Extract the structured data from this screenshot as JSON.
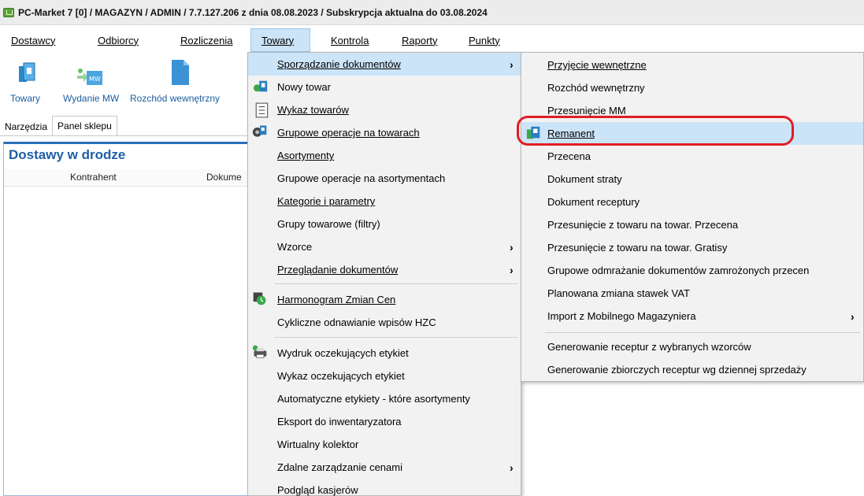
{
  "window": {
    "title": "PC-Market 7 [0] / MAGAZYN / ADMIN / 7.7.127.206 z dnia 08.08.2023 / Subskrypcja aktualna do 03.08.2024"
  },
  "menubar": [
    {
      "label": "Dostawcy",
      "name": "menu-dostawcy"
    },
    {
      "label": "Odbiorcy",
      "name": "menu-odbiorcy"
    },
    {
      "label": "Rozliczenia",
      "name": "menu-rozliczenia"
    },
    {
      "label": "Towary",
      "name": "menu-towary"
    },
    {
      "label": "Kontrola",
      "name": "menu-kontrola"
    },
    {
      "label": "Raporty",
      "name": "menu-raporty"
    },
    {
      "label": "Punkty",
      "name": "menu-punkty"
    }
  ],
  "toolbar": {
    "towary": "Towary",
    "wydanie_mw": "Wydanie MW",
    "rozchod": "Rozchód wewnętrzny",
    "mw_badge": "MW"
  },
  "tabs": {
    "narzedzia": "Narzędzia",
    "panel_sklepu": "Panel sklepu"
  },
  "panel": {
    "title": "Dostawy w drodze",
    "columns": [
      "Kontrahent",
      "Dokume"
    ]
  },
  "towary_menu": [
    {
      "label": "Sporządzanie dokumentów",
      "submenu": true,
      "highlight": true,
      "icon": ""
    },
    {
      "label": "Nowy towar",
      "icon": "new-product-icon"
    },
    {
      "label": "Wykaz towarów",
      "icon": "list-icon"
    },
    {
      "label": "Grupowe operacje na towarach",
      "icon": "group-ops-icon"
    },
    {
      "label": "Asortymenty",
      "icon": ""
    },
    {
      "label": "Grupowe operacje na asortymentach",
      "icon": ""
    },
    {
      "label": "Kategorie i parametry",
      "icon": ""
    },
    {
      "label": "Grupy towarowe (filtry)",
      "icon": ""
    },
    {
      "label": "Wzorce",
      "submenu": true,
      "icon": ""
    },
    {
      "label": "Przeglądanie dokumentów",
      "submenu": true,
      "icon": ""
    },
    {
      "separator": true
    },
    {
      "label": "Harmonogram Zmian Cen",
      "icon": "schedule-icon"
    },
    {
      "label": "Cykliczne odnawianie wpisów HZC",
      "icon": ""
    },
    {
      "separator": true
    },
    {
      "label": "Wydruk oczekujących etykiet",
      "icon": "printer-icon"
    },
    {
      "label": "Wykaz oczekujących etykiet",
      "icon": ""
    },
    {
      "label": "Automatyczne etykiety - które asortymenty",
      "icon": ""
    },
    {
      "label": "Eksport do inwentaryzatora",
      "icon": ""
    },
    {
      "label": "Wirtualny kolektor",
      "icon": ""
    },
    {
      "label": "Zdalne zarządzanie cenami",
      "submenu": true,
      "icon": ""
    },
    {
      "label": "Podgląd kasjerów",
      "icon": ""
    }
  ],
  "documents_submenu": [
    {
      "label": "Przyjęcie wewnętrzne"
    },
    {
      "label": "Rozchód wewnętrzny"
    },
    {
      "label": "Przesunięcie MM"
    },
    {
      "label": "Remanent",
      "highlight": true,
      "icon": "stocktaking-icon"
    },
    {
      "label": "Przecena"
    },
    {
      "label": "Dokument straty"
    },
    {
      "label": "Dokument receptury"
    },
    {
      "label": "Przesunięcie z towaru na towar. Przecena"
    },
    {
      "label": "Przesunięcie z towaru na towar. Gratisy"
    },
    {
      "label": "Grupowe odmrażanie dokumentów zamrożonych przecen"
    },
    {
      "label": "Planowana zmiana stawek VAT"
    },
    {
      "label": "Import z Mobilnego Magazyniera",
      "submenu": true
    },
    {
      "separator": true
    },
    {
      "label": "Generowanie receptur z wybranych wzorców"
    },
    {
      "label": "Generowanie zbiorczych receptur wg dziennej sprzedaży"
    }
  ],
  "colors": {
    "highlight": "#cce4f7",
    "accent": "#1f5fa8",
    "annotation": "#e01e24"
  }
}
